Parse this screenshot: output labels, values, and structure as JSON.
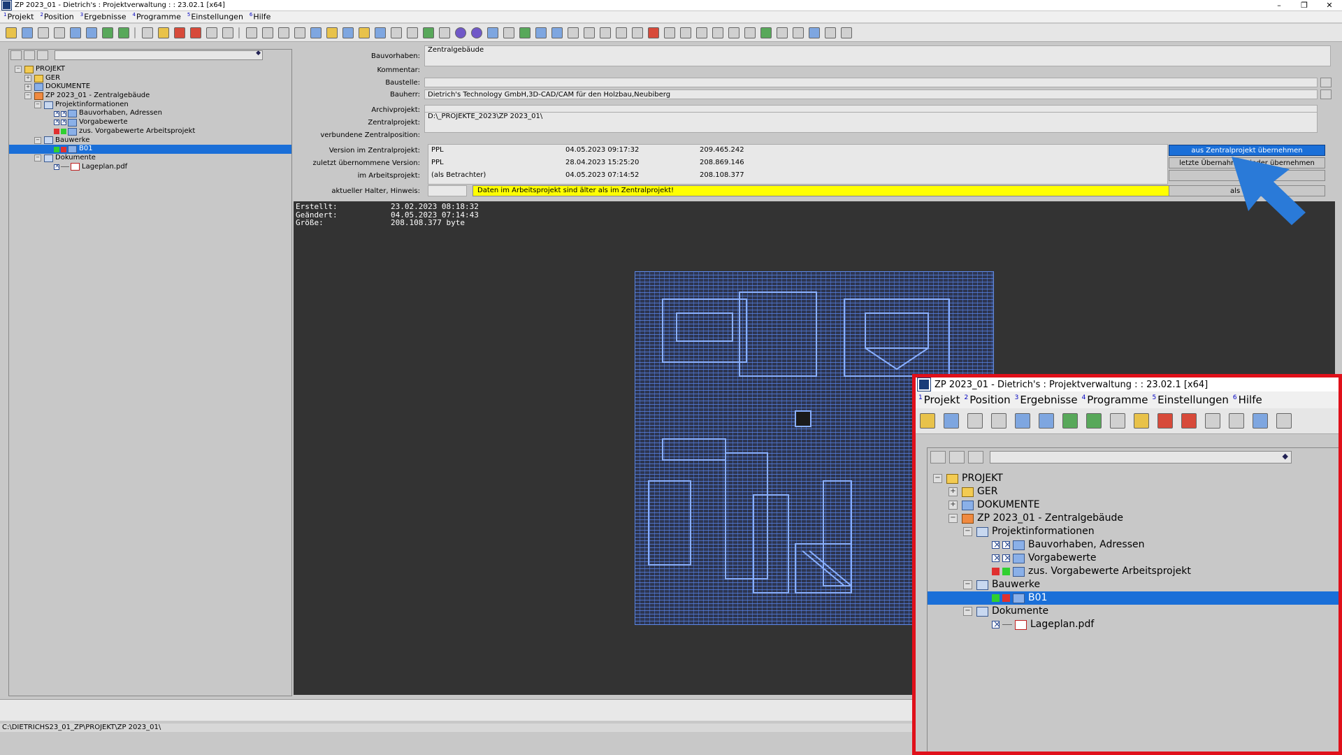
{
  "window": {
    "title": "ZP 2023_01 - Dietrich's : Projektverwaltung : : 23.02.1 [x64]",
    "controls": [
      "–",
      "❐",
      "✕"
    ]
  },
  "menu": [
    {
      "num": "1",
      "label": "Projekt"
    },
    {
      "num": "2",
      "label": "Position"
    },
    {
      "num": "3",
      "label": "Ergebnisse"
    },
    {
      "num": "4",
      "label": "Programme"
    },
    {
      "num": "5",
      "label": "Einstellungen"
    },
    {
      "num": "6",
      "label": "Hilfe"
    }
  ],
  "tree": {
    "root": "PROJEKT",
    "ger": "GER",
    "dokumente": "DOKUMENTE",
    "zp": "ZP 2023_01 - Zentralgebäude",
    "projektinfo": "Projektinformationen",
    "bauvorhaben": "Bauvorhaben, Adressen",
    "vorgabewerte": "Vorgabewerte",
    "zus_vorgabewerte": "zus. Vorgabewerte Arbeitsprojekt",
    "bauwerke": "Bauwerke",
    "b01": "B01",
    "dokumente_sub": "Dokumente",
    "lageplan": "Lageplan.pdf"
  },
  "form": {
    "bauvorhaben_label": "Bauvorhaben:",
    "bauvorhaben_value": "Zentralgebäude",
    "kommentar_label": "Kommentar:",
    "baustelle_label": "Baustelle:",
    "bauherr_label": "Bauherr:",
    "bauherr_value": "Dietrich's Technology GmbH,3D-CAD/CAM für den Holzbau,Neubiberg",
    "archivprojekt_label": "Archivprojekt:",
    "zentralprojekt_label": "Zentralprojekt:",
    "zentralprojekt_value": "D:\\_PROJEKTE_2023\\ZP 2023_01\\",
    "verbundene_label": "verbundene Zentralposition:",
    "version_zentral_label": "Version im Zentralprojekt:",
    "zuletzt_label": "zuletzt übernommene Version:",
    "arbeitsprojekt_label": "im Arbeitsprojekt:",
    "halter_label": "aktueller Halter, Hinweis:",
    "hinweis": "Daten im Arbeitsprojekt sind älter als im Zentralprojekt!"
  },
  "versions": [
    {
      "who": "PPL",
      "date": "04.05.2023 09:17:32",
      "size": "209.465.242"
    },
    {
      "who": "PPL",
      "date": "28.04.2023 15:25:20",
      "size": "208.869.146"
    },
    {
      "who": "(als Betrachter)",
      "date": "04.05.2023 07:14:52",
      "size": "208.108.377"
    }
  ],
  "buttons": {
    "aus_zentral": "aus Zentralprojekt übernehmen",
    "letzte": "letzte Übernahme wieder übernehmen",
    "als_halter": "als Halter"
  },
  "preview": {
    "erstellt_label": "Erstellt:",
    "erstellt": "23.02.2023 08:18:32",
    "geaendert_label": "Geändert:",
    "geaendert": "04.05.2023 07:14:43",
    "groesse_label": "Größe:",
    "groesse": "208.108.377 byte"
  },
  "statusbar": {
    "path": "C:\\DIETRICHS23_01_ZP\\PROJEKT\\ZP 2023_01\\"
  },
  "colors": {
    "selection": "#1a6fd8",
    "highlight_border": "#e0101a",
    "warning_bg": "#ffff00",
    "arrow": "#2a7ad8"
  },
  "icons": [
    "app-icon",
    "folder-icon",
    "chart-icon",
    "pdf-icon",
    "expand-icon",
    "collapse-icon",
    "pointer-arrow-icon"
  ]
}
